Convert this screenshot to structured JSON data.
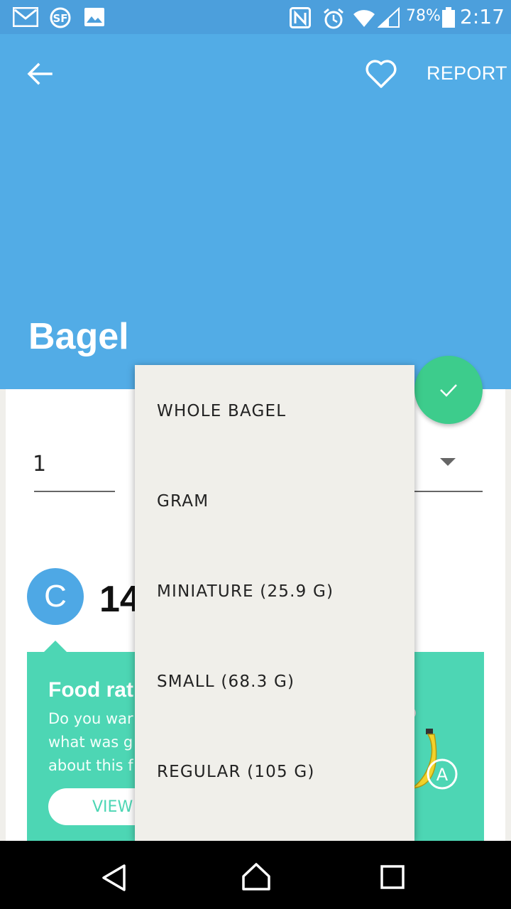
{
  "status_bar": {
    "icons": [
      "gmail-icon",
      "sf-app-icon",
      "gallery-icon",
      "nfc-icon",
      "alarm-icon",
      "wifi-icon",
      "signal-icon",
      "battery-icon"
    ],
    "battery": "78%",
    "time": "2:17"
  },
  "header": {
    "report_label": "REPORT",
    "title": "Bagel",
    "color": "#52ace6"
  },
  "form": {
    "quantity": "1"
  },
  "rating": {
    "grade": "C",
    "calories_partial": "14"
  },
  "banner": {
    "title": "Food rat",
    "body_lines": [
      "Do you war",
      "what was g",
      "about this f"
    ],
    "button_label": "VIEW",
    "color": "#4dd6b4"
  },
  "unit_menu": {
    "options": [
      "WHOLE BAGEL",
      "GRAM",
      "MINIATURE (25.9 G)",
      "SMALL (68.3 G)",
      "REGULAR (105 G)"
    ]
  },
  "fab": {
    "color": "#3dcc8c"
  }
}
